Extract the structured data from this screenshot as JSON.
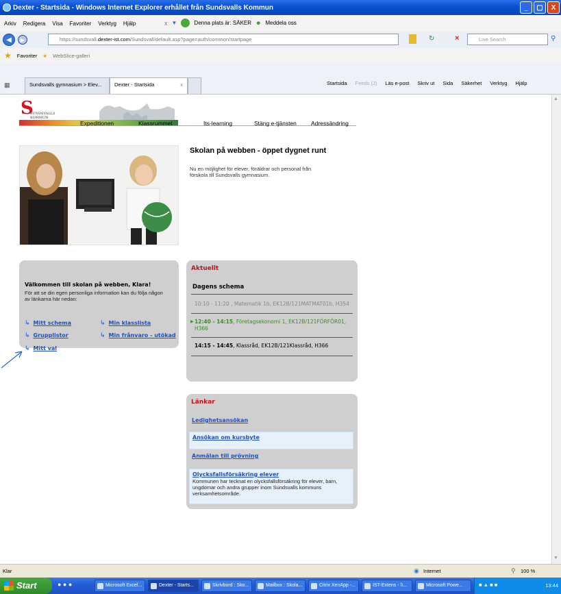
{
  "window": {
    "title": "Dexter - Startsida - Windows Internet Explorer erhållet från Sundsvalls Kommun",
    "min": "_",
    "max": "▢",
    "close": "X"
  },
  "menubar": {
    "items": [
      "Arkiv",
      "Redigera",
      "Visa",
      "Favoriter",
      "Verktyg",
      "Hjälp"
    ],
    "security_text": "Denna plats är: SÄKER",
    "report_text": "Meddela oss"
  },
  "address": {
    "url_prefix": "https://sundsvall.",
    "url_domain": "dexter-ist.com",
    "url_rest": "/Sundsvall/default.asp?page=auth/common/startpage",
    "search_placeholder": "Live Search"
  },
  "favbar": {
    "favorites": "Favoriter",
    "webslice": "WebSlice-galleri"
  },
  "tabs": [
    {
      "label": "Sundsvalls gymnasium > Elev..."
    },
    {
      "label": "Dexter - Startsida"
    }
  ],
  "commandbar": [
    "Startsida",
    "Feeds (J)",
    "Läs e-post",
    "Skriv ut",
    "Sida",
    "Säkerhet",
    "Verktyg",
    "Hjälp"
  ],
  "logo": {
    "letter": "S",
    "line1": "SUNDSVALLS",
    "line2": "KOMMUN"
  },
  "sitenav": [
    "Expeditionen",
    "Klassrummet",
    "Its-learning",
    "Stäng e-tjänsten",
    "Adressändring"
  ],
  "intro": {
    "title": "Skolan på webben - öppet dygnet runt",
    "text": "Nu en möjlighet för elever, föräldrar och personal från förskola till Sundsvalls gymnasium."
  },
  "welcome": {
    "title": "Välkommen till skolan på webben, Klara!",
    "text": "För att se din egen personliga information kan du följa någon av länkarna här nedan:",
    "links": [
      "Mitt schema",
      "Min klasslista",
      "Grupplistor",
      "Min frånvaro - utökad",
      "Mitt val"
    ]
  },
  "aktuellt": {
    "heading": "Aktuellt",
    "schedule_title": "Dagens schema",
    "items": [
      {
        "time": "10:10 - 11:20",
        "text": " , Matematik 1b, EK12B/121MATMAT01b, H354"
      },
      {
        "time": "12:40 - 14:15",
        "text": ", Företagsekonomi 1, EK12B/121FÖRFÖR01, H366"
      },
      {
        "time": "14:15 - 14:45",
        "text": ", Klassråd, EK12B/121Klassråd, H366"
      }
    ]
  },
  "lankar": {
    "heading": "Länkar",
    "links": [
      {
        "label": "Ledighetsansökan"
      },
      {
        "label": "Ansökan om kursbyte"
      },
      {
        "label": "Anmälan till prövning"
      },
      {
        "label": "Olycksfallsförsäkring elever",
        "desc": "Kommunen har tecknat en olycksfallsförsäkring för elever, barn, ungdomar och andra grupper inom Sundsvalls kommuns verksamhetsområde."
      }
    ]
  },
  "status": {
    "ready": "Klar",
    "zone": "Internet",
    "zoom": "100 %"
  },
  "taskbar": {
    "start": "Start",
    "tasks": [
      "Microsoft Excel...",
      "Dexter - Starts...",
      "Skrivbord : Sko...",
      "Mailbox : Skola...",
      "Citrix XenApp -...",
      "IST-Extens - \\\\...",
      "Microsoft Powe..."
    ],
    "clock": "13:44"
  }
}
